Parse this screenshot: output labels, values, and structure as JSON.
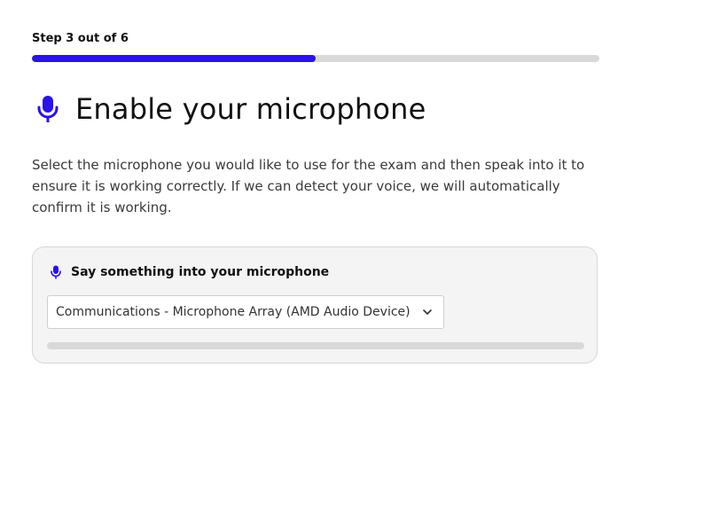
{
  "progress": {
    "label": "Step 3 out of 6",
    "current_step": 3,
    "total_steps": 6,
    "fraction": 0.5,
    "fill_color": "#2a12e8",
    "track_color": "#d9d9d9"
  },
  "heading": {
    "icon": "microphone-icon",
    "title": "Enable your microphone"
  },
  "description": "Select the microphone you would like to use for the exam and then speak into it to ensure it is working correctly. If we can detect your voice, we will automatically confirm it is working.",
  "mic_card": {
    "icon": "microphone-icon",
    "title": "Say something into your microphone",
    "select": {
      "selected_value": "Communications - Microphone Array (AMD Audio Device)",
      "icon": "chevron-down-icon"
    },
    "input_level": 0
  },
  "colors": {
    "accent": "#2a12e8"
  }
}
